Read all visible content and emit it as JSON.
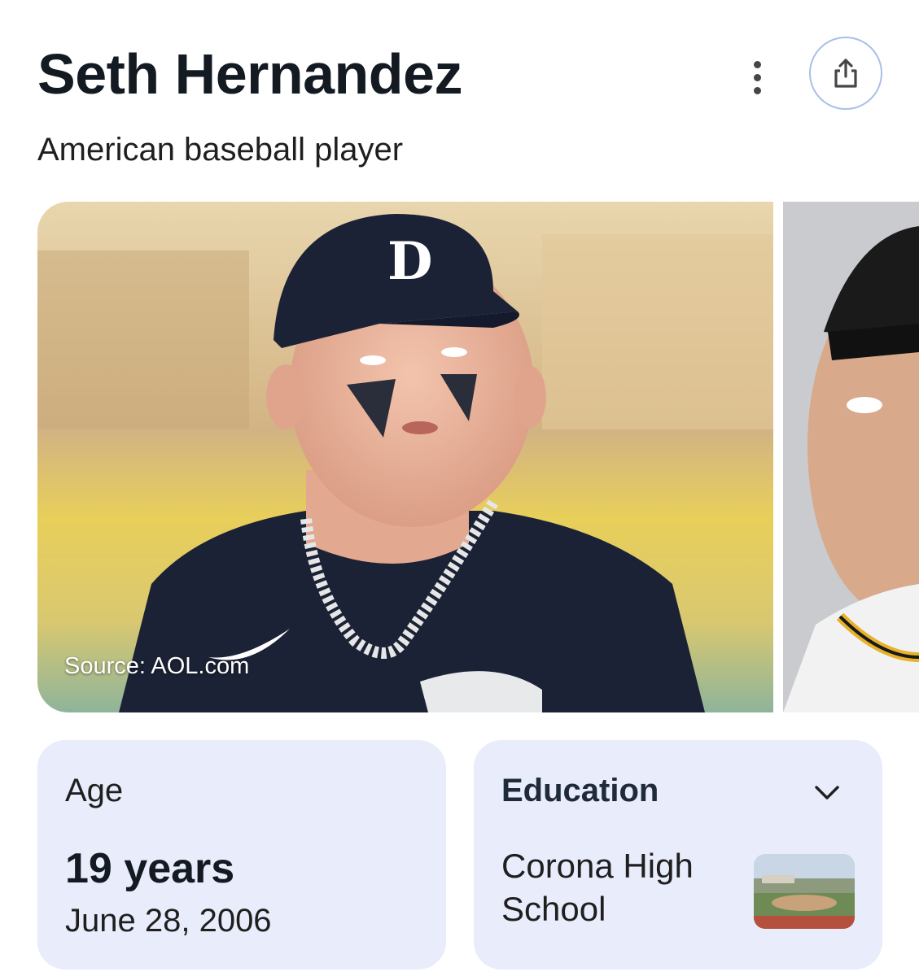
{
  "header": {
    "title": "Seth Hernandez",
    "subtitle": "American baseball player",
    "more_icon": "more-vert-icon",
    "share_icon": "share-icon"
  },
  "images": {
    "main_source": "Source: AOL.com"
  },
  "facts": {
    "age": {
      "label": "Age",
      "value": "19 years",
      "date": "June 28, 2006"
    },
    "education": {
      "label": "Education",
      "value": "Corona High School",
      "expand_icon": "chevron-down-icon"
    }
  },
  "colors": {
    "card_bg": "#e8ecfb",
    "share_border": "#a8c0e8",
    "title": "#141a22"
  }
}
